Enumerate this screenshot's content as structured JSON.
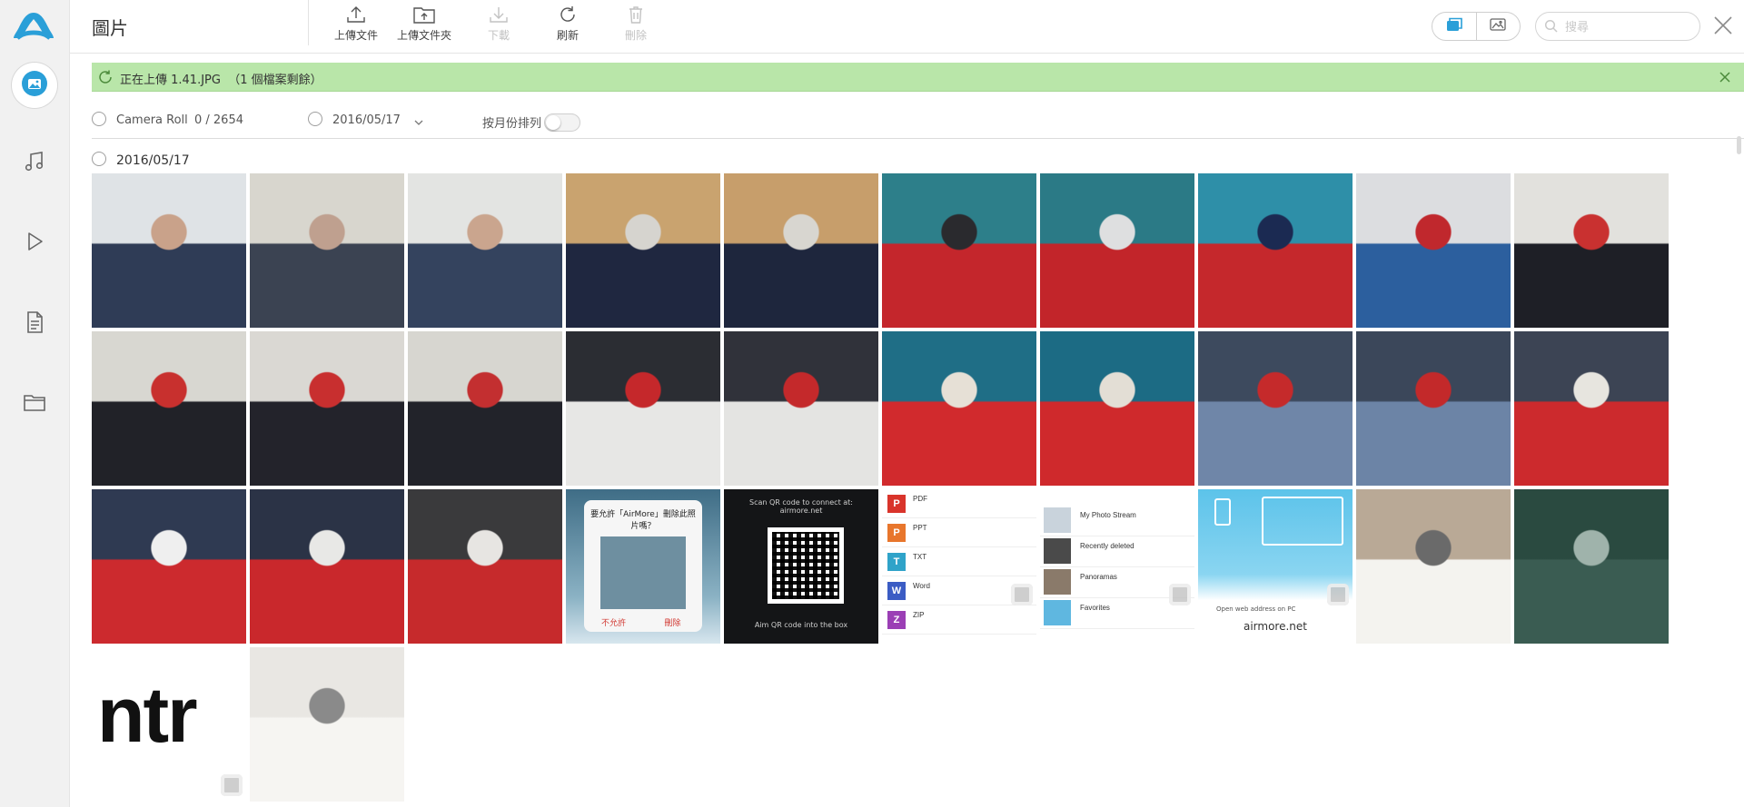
{
  "app": {
    "brand_color": "#2a9fd8",
    "nav": [
      {
        "icon": "photos-icon",
        "active": true
      },
      {
        "icon": "music-icon",
        "active": false
      },
      {
        "icon": "video-icon",
        "active": false
      },
      {
        "icon": "documents-icon",
        "active": false
      },
      {
        "icon": "files-folder-icon",
        "active": false
      }
    ]
  },
  "header": {
    "title": "圖片",
    "tools": [
      {
        "label": "上傳文件",
        "icon": "upload-file-icon",
        "enabled": true
      },
      {
        "label": "上傳文件夾",
        "icon": "upload-folder-icon",
        "enabled": true
      },
      {
        "label": "下載",
        "icon": "download-icon",
        "enabled": false
      },
      {
        "label": "刷新",
        "icon": "refresh-icon",
        "enabled": true
      },
      {
        "label": "刪除",
        "icon": "trash-icon",
        "enabled": false
      }
    ],
    "search_placeholder": "搜尋"
  },
  "banner": {
    "text": "正在上傳 1.41.JPG  （1 個檔案剩餘）",
    "color": "#b9e6a9"
  },
  "filters": {
    "album": "Camera Roll",
    "selection_count": "0 / 2654",
    "date": "2016/05/17",
    "sort_by_month_label": "按月份排列",
    "sort_by_month_enabled": false
  },
  "group": {
    "date": "2016/05/17",
    "photos": [
      {
        "kind": "photo",
        "subject": "man laughing",
        "palette": [
          "#dfe3e6",
          "#2f3c56",
          "#c9a28a"
        ]
      },
      {
        "kind": "photo",
        "subject": "students selfie",
        "palette": [
          "#d8d6ce",
          "#3b4352",
          "#bfa08f"
        ]
      },
      {
        "kind": "photo",
        "subject": "two friends smiling",
        "palette": [
          "#e3e4e2",
          "#34435e",
          "#caa58e"
        ]
      },
      {
        "kind": "photo",
        "subject": "student in hoodie",
        "palette": [
          "#c9a36f",
          "#1f2740",
          "#d6d4cf"
        ]
      },
      {
        "kind": "photo",
        "subject": "student in hoodie",
        "palette": [
          "#c79e6b",
          "#1e263d",
          "#d8d6d0"
        ]
      },
      {
        "kind": "photo",
        "subject": "students red jacket",
        "palette": [
          "#2d7f8a",
          "#c4262c",
          "#2a2a2e"
        ]
      },
      {
        "kind": "photo",
        "subject": "students red jacket",
        "palette": [
          "#2b7a86",
          "#c2252a",
          "#dedfe0"
        ]
      },
      {
        "kind": "photo",
        "subject": "students laughing",
        "palette": [
          "#2e8fa8",
          "#c5282c",
          "#1b2a52"
        ]
      },
      {
        "kind": "photo",
        "subject": "classroom",
        "palette": [
          "#dcdde0",
          "#2c5f9e",
          "#c0282d"
        ]
      },
      {
        "kind": "photo",
        "subject": "group photo",
        "palette": [
          "#e2e1dd",
          "#1e1f26",
          "#c93130"
        ]
      },
      {
        "kind": "photo",
        "subject": "group photo",
        "palette": [
          "#d8d7d1",
          "#212228",
          "#c8302e"
        ]
      },
      {
        "kind": "photo",
        "subject": "group photo",
        "palette": [
          "#dad8d3",
          "#23232b",
          "#c82f2f"
        ]
      },
      {
        "kind": "photo",
        "subject": "group photo",
        "palette": [
          "#d7d6d0",
          "#22232a",
          "#c32f30"
        ]
      },
      {
        "kind": "photo",
        "subject": "students dark room",
        "palette": [
          "#2b2d33",
          "#e7e7e5",
          "#c5282b"
        ]
      },
      {
        "kind": "photo",
        "subject": "students dark room",
        "palette": [
          "#30323a",
          "#e4e4e2",
          "#c4292b"
        ]
      },
      {
        "kind": "photo",
        "subject": "peace sign",
        "palette": [
          "#1f6e86",
          "#d12a2d",
          "#e6e0d6"
        ]
      },
      {
        "kind": "photo",
        "subject": "peace sign",
        "palette": [
          "#1c6b84",
          "#cf292c",
          "#e3ded5"
        ]
      },
      {
        "kind": "photo",
        "subject": "white cap",
        "palette": [
          "#3d4a5e",
          "#6f86a8",
          "#c52a2b"
        ]
      },
      {
        "kind": "photo",
        "subject": "white cap",
        "palette": [
          "#3b475a",
          "#6c84a6",
          "#c3292a"
        ]
      },
      {
        "kind": "photo",
        "subject": "birthday cake",
        "palette": [
          "#3c4454",
          "#cc2a2d",
          "#e7e5df"
        ]
      },
      {
        "kind": "photo",
        "subject": "birthday cake",
        "palette": [
          "#2f3a52",
          "#cc2a2e",
          "#efefef"
        ]
      },
      {
        "kind": "photo",
        "subject": "birthday cake",
        "palette": [
          "#2b3346",
          "#c9282c",
          "#e8e8e6"
        ]
      },
      {
        "kind": "photo",
        "subject": "birthday cake",
        "palette": [
          "#3a3a3c",
          "#c62a2c",
          "#e7e5e2"
        ]
      },
      {
        "kind": "dialog-shot",
        "title": "要允許「AirMore」刪除此照片嗎？",
        "cancel": "不允許",
        "delete": "刪除"
      },
      {
        "kind": "qr-shot",
        "top": "Scan QR code to connect at:\nairmore.net",
        "bottom": "Aim QR code into the box"
      },
      {
        "kind": "list-shot",
        "rows": [
          [
            "PDF",
            "#d9342b"
          ],
          [
            "PPT",
            "#e8762c"
          ],
          [
            "TXT",
            "#2fa3c9"
          ],
          [
            "Word",
            "#3b5cc4"
          ],
          [
            "ZIP",
            "#9b3fb5"
          ]
        ]
      },
      {
        "kind": "album-shot",
        "rows": [
          "My Photo Stream",
          "Recently deleted",
          "Panoramas",
          "Favorites"
        ]
      },
      {
        "kind": "web-shot",
        "line1": "Open web address on PC",
        "line2": "airmore.net"
      },
      {
        "kind": "photo",
        "subject": "paper notes",
        "palette": [
          "#b9a996",
          "#f4f3ef",
          "#6a6a6a"
        ]
      },
      {
        "kind": "photo",
        "subject": "blackboard",
        "palette": [
          "#2a4a40",
          "#3a5c52",
          "#9fb3ab"
        ]
      },
      {
        "kind": "ntr-shot",
        "text": "ntr"
      },
      {
        "kind": "photo",
        "subject": "handwritten note",
        "palette": [
          "#e9e7e3",
          "#f6f5f2",
          "#8a8a8a"
        ]
      }
    ]
  }
}
